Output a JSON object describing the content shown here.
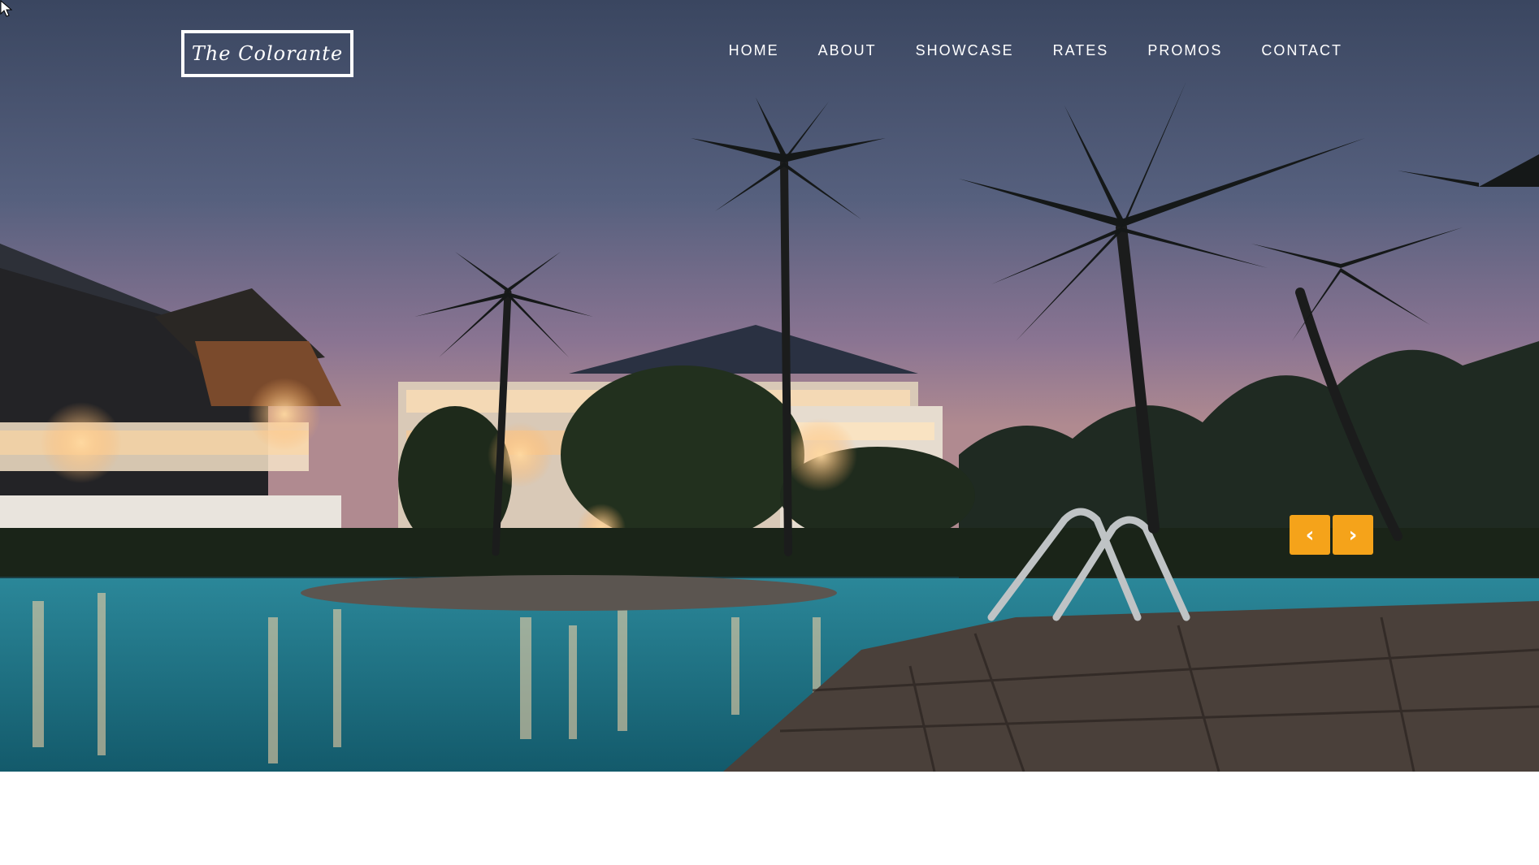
{
  "logo": {
    "text": "The Colorante"
  },
  "nav": {
    "items": [
      {
        "label": "HOME"
      },
      {
        "label": "ABOUT"
      },
      {
        "label": "SHOWCASE"
      },
      {
        "label": "RATES"
      },
      {
        "label": "PROMOS"
      },
      {
        "label": "CONTACT"
      }
    ]
  },
  "slider": {
    "prev_label": "‹",
    "next_label": "›",
    "accent_color": "#f5a31a"
  },
  "hero": {
    "image_subject": "resort-pool-at-dusk"
  }
}
